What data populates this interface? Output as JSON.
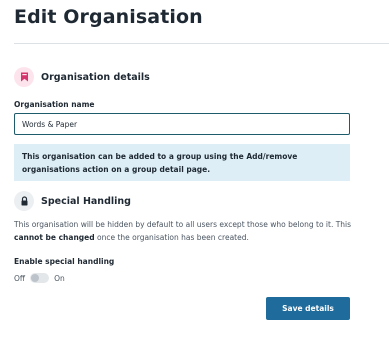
{
  "page": {
    "title": "Edit Organisation"
  },
  "details_section": {
    "title": "Organisation details",
    "icon": "bookmark-icon",
    "icon_color": "#d6336c"
  },
  "name_field": {
    "label": "Organisation name",
    "value": "Words & Paper"
  },
  "info_box": {
    "text": "This organisation can be added to a group using the Add/remove organisations action on a group detail page.",
    "background": "#ddeef6"
  },
  "special_section": {
    "title": "Special Handling",
    "icon": "lock-icon",
    "description_part1": "This organisation will be hidden by default to all users except those who belong to it. This ",
    "description_bold": "cannot be changed",
    "description_part2": " once the organisation has been created."
  },
  "special_handling": {
    "label": "Enable special handling",
    "off_label": "Off",
    "on_label": "On",
    "enabled": false
  },
  "actions": {
    "save_label": "Save details",
    "save_color": "#1f6c9c"
  }
}
